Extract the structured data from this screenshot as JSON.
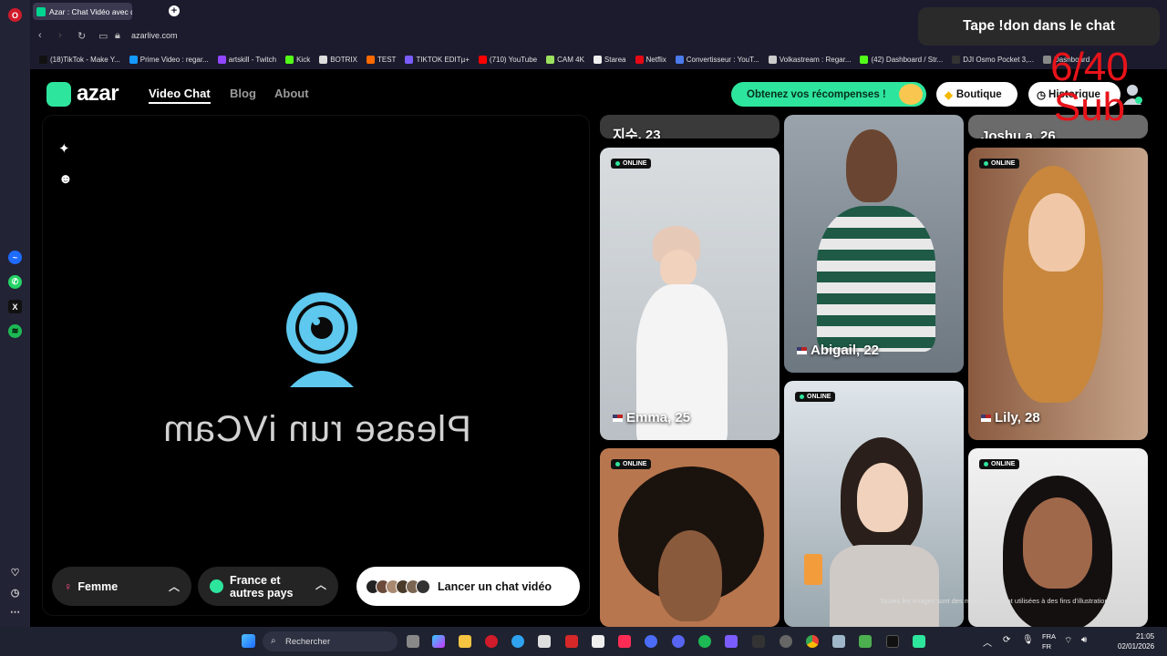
{
  "browser": {
    "tab_title": "Azar : Chat Vidéo avec de",
    "url": "azarlive.com",
    "bookmarks": [
      {
        "label": "(18)TikTok - Make Y...",
        "color": "#111111"
      },
      {
        "label": "Prime Video : regar...",
        "color": "#1399ff"
      },
      {
        "label": "artskill - Twitch",
        "color": "#9146ff"
      },
      {
        "label": "Kick",
        "color": "#53fc18"
      },
      {
        "label": "BOTRIX",
        "color": "#dddddd"
      },
      {
        "label": "TEST",
        "color": "#ff6a00"
      },
      {
        "label": "TIKTOK EDITµ+",
        "color": "#7b5cff"
      },
      {
        "label": "(710) YouTube",
        "color": "#ff0000"
      },
      {
        "label": "CAM 4K",
        "color": "#9be15d"
      },
      {
        "label": "Starea",
        "color": "#eeeeee"
      },
      {
        "label": "Netflix",
        "color": "#e50914"
      },
      {
        "label": "Convertisseur : YouT...",
        "color": "#4b7bec"
      },
      {
        "label": "Volkastream : Regar...",
        "color": "#cccccc"
      },
      {
        "label": "(42) Dashboard / Str...",
        "color": "#53fc18"
      },
      {
        "label": "DJI Osmo Pocket 3,...",
        "color": "#333333"
      },
      {
        "label": "Dashboard",
        "color": "#888888"
      }
    ]
  },
  "header": {
    "logo": "azar",
    "nav": [
      "Video Chat",
      "Blog",
      "About"
    ],
    "rewards": "Obtenez vos récompenses !",
    "shop": "Boutique",
    "history": "Historique"
  },
  "camera": {
    "message": "Please run iVCam",
    "gender": "Femme",
    "country_line1": "France et",
    "country_line2": "autres pays",
    "launch": "Lancer un chat vidéo"
  },
  "cards": {
    "online_label": "ONLINE",
    "top_left_name": "지수, 23",
    "top_right_name": "Joshu a, 26",
    "emma": "Emma, 25",
    "abigail": "Abigail, 22",
    "lily": "Lily, 28"
  },
  "disclaimer": "Toutes les images sont des modèles et sont utilisées à des fins d'illustration uniquement.",
  "overlay": {
    "banner": "Tape !don dans le chat",
    "sub_count": "6/40",
    "sub_label": "Sub"
  },
  "taskbar": {
    "search": "Rechercher",
    "lang1": "FRA",
    "lang2": "FR",
    "time": "21:05",
    "date": "02/01/2026"
  }
}
